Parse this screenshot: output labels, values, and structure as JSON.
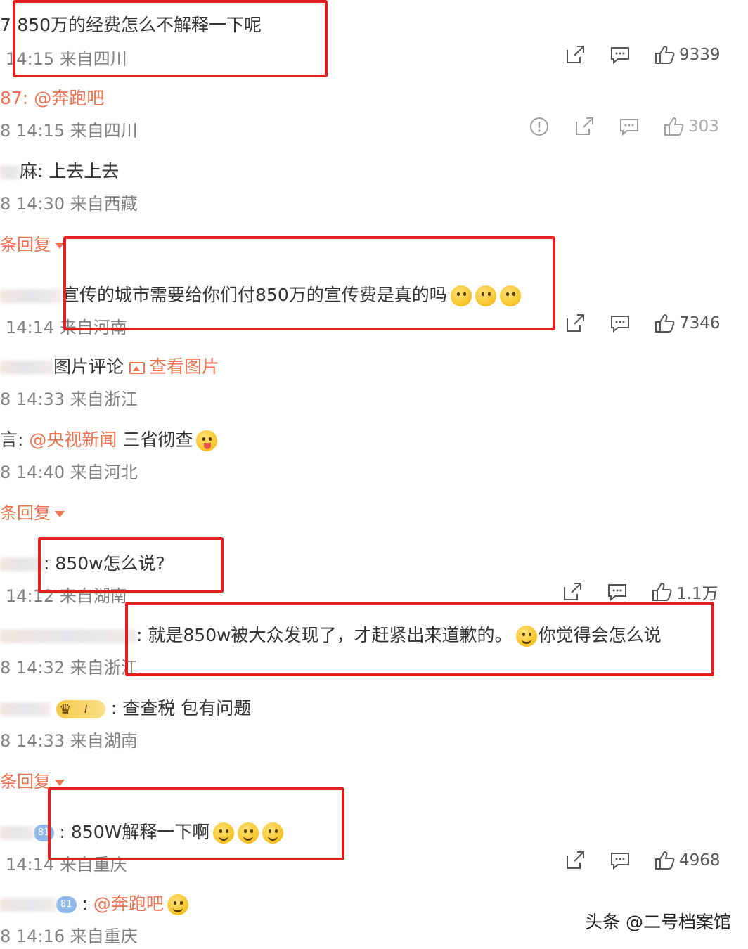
{
  "comments": [
    {
      "prefix": "7:",
      "text": "850万的经费怎么不解释一下呢",
      "time": "14:15 来自四川",
      "likes": "9339"
    },
    {
      "prefix": "87:",
      "mention": "@奔跑吧",
      "time": "8 14:15 来自四川",
      "likes": "303"
    },
    {
      "prefix": "麻:",
      "text": "上去上去",
      "time": "8 14:30 来自西藏"
    },
    {
      "text": "宣传的城市需要给你们付850万的宣传费是真的吗",
      "time": "14:14 来自河南",
      "likes": "7346"
    },
    {
      "text": "图片评论",
      "link": "查看图片",
      "time": "8 14:33 来自浙江"
    },
    {
      "prefix": "言:",
      "mention": "@央视新闻",
      "text": "三省彻查",
      "time": "8 14:40 来自河北"
    },
    {
      "prefix": ":",
      "text": "850w怎么说?",
      "time": "14:12 来自湖南",
      "likes": "1.1万"
    },
    {
      "prefix": ":",
      "text": "就是850w被大众发现了，才赶紧出来道歉的。",
      "text2": "你觉得会怎么说",
      "time": "8 14:32 来自浙江"
    },
    {
      "badge": "I",
      "prefix": ":",
      "text": "查查税  包有问题",
      "time": "8 14:33 来自湖南"
    },
    {
      "badge": "81",
      "prefix": ":",
      "text": "850W解释一下啊",
      "time": "14:14 来自重庆",
      "likes": "4968"
    },
    {
      "badge": "81",
      "prefix": ":",
      "mention": "@奔跑吧",
      "time": "8 14:16 来自重庆"
    }
  ],
  "reply_toggle": "条回复",
  "watermark": "头条 @二号档案馆",
  "colors": {
    "link": "#eb7350",
    "highlight": "#e02020"
  }
}
